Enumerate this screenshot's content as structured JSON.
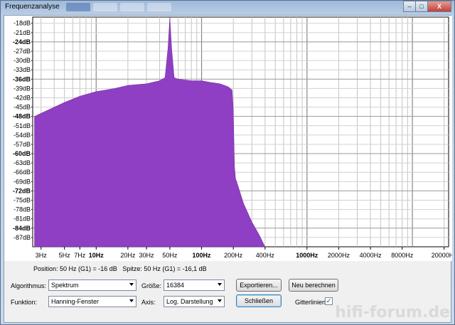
{
  "window": {
    "title": "Frequenzanalyse",
    "buttons": {
      "minimize": "–",
      "maximize": "□",
      "close": "X"
    }
  },
  "plot": {
    "fill_color": "#8f3fc3",
    "y_labels": [
      "-18dB",
      "-21dB",
      "-24dB",
      "-27dB",
      "-30dB",
      "-33dB",
      "-36dB",
      "-39dB",
      "-42dB",
      "-45dB",
      "-48dB",
      "-51dB",
      "-54dB",
      "-57dB",
      "-60dB",
      "-63dB",
      "-66dB",
      "-69dB",
      "-72dB",
      "-75dB",
      "-78dB",
      "-81dB",
      "-84dB",
      "-87dB"
    ],
    "y_bold": [
      "-24dB",
      "-36dB",
      "-48dB",
      "-60dB",
      "-72dB",
      "-84dB"
    ],
    "x_labels": [
      {
        "text": "3Hz",
        "hz": 3,
        "bold": false
      },
      {
        "text": "5Hz",
        "hz": 5,
        "bold": false
      },
      {
        "text": "7Hz",
        "hz": 7,
        "bold": false
      },
      {
        "text": "10Hz",
        "hz": 10,
        "bold": true
      },
      {
        "text": "20Hz",
        "hz": 20,
        "bold": false
      },
      {
        "text": "30Hz",
        "hz": 30,
        "bold": false
      },
      {
        "text": "50Hz",
        "hz": 50,
        "bold": false
      },
      {
        "text": "100Hz",
        "hz": 100,
        "bold": true
      },
      {
        "text": "200Hz",
        "hz": 200,
        "bold": false
      },
      {
        "text": "400Hz",
        "hz": 400,
        "bold": false
      },
      {
        "text": "1000Hz",
        "hz": 1000,
        "bold": true
      },
      {
        "text": "2000Hz",
        "hz": 2000,
        "bold": false
      },
      {
        "text": "4000Hz",
        "hz": 4000,
        "bold": false
      },
      {
        "text": "8000Hz",
        "hz": 8000,
        "bold": false
      },
      {
        "text": "20000Hz",
        "hz": 20000,
        "bold": false
      }
    ]
  },
  "chart_data": {
    "type": "area",
    "xlabel": "",
    "ylabel": "",
    "x_scale": "log",
    "xlim": [
      2.5,
      22050
    ],
    "ylim": [
      -90,
      -16
    ],
    "grid": true,
    "series": [
      {
        "x": [
          2.6,
          3,
          5,
          7,
          10,
          15,
          20,
          30,
          40,
          45,
          48,
          50,
          52,
          55,
          60,
          80,
          100,
          120,
          150,
          180,
          195,
          200,
          205,
          210,
          220,
          250,
          300,
          350,
          400
        ],
        "y": [
          -48,
          -47,
          -43.5,
          -41.5,
          -40,
          -39,
          -38,
          -37.5,
          -36.5,
          -35.5,
          -26,
          -16,
          -26,
          -35.5,
          -36,
          -36.5,
          -36.5,
          -37,
          -37.5,
          -38.5,
          -39.5,
          -46,
          -64,
          -68,
          -70,
          -76,
          -82,
          -86,
          -90
        ]
      }
    ]
  },
  "status": {
    "position": "Position: 50 Hz (G1) = -16 dB",
    "peak": "Spitze: 50 Hz (G1) = -16,1 dB"
  },
  "controls": {
    "algorithm_label": "Algorithmus:",
    "algorithm_value": "Spektrum",
    "function_label": "Funktion:",
    "function_value": "Hanning-Fenster",
    "size_label": "Größe:",
    "size_value": "16384",
    "axis_label": "Axis:",
    "axis_value": "Log. Darstellung",
    "export_button": "Exportieren...",
    "recalc_button": "Neu berechnen",
    "close_button": "Schließen",
    "gridlines_label": "Gitterlinien",
    "gridlines_checked": true,
    "gridlines_mark": "✓"
  }
}
